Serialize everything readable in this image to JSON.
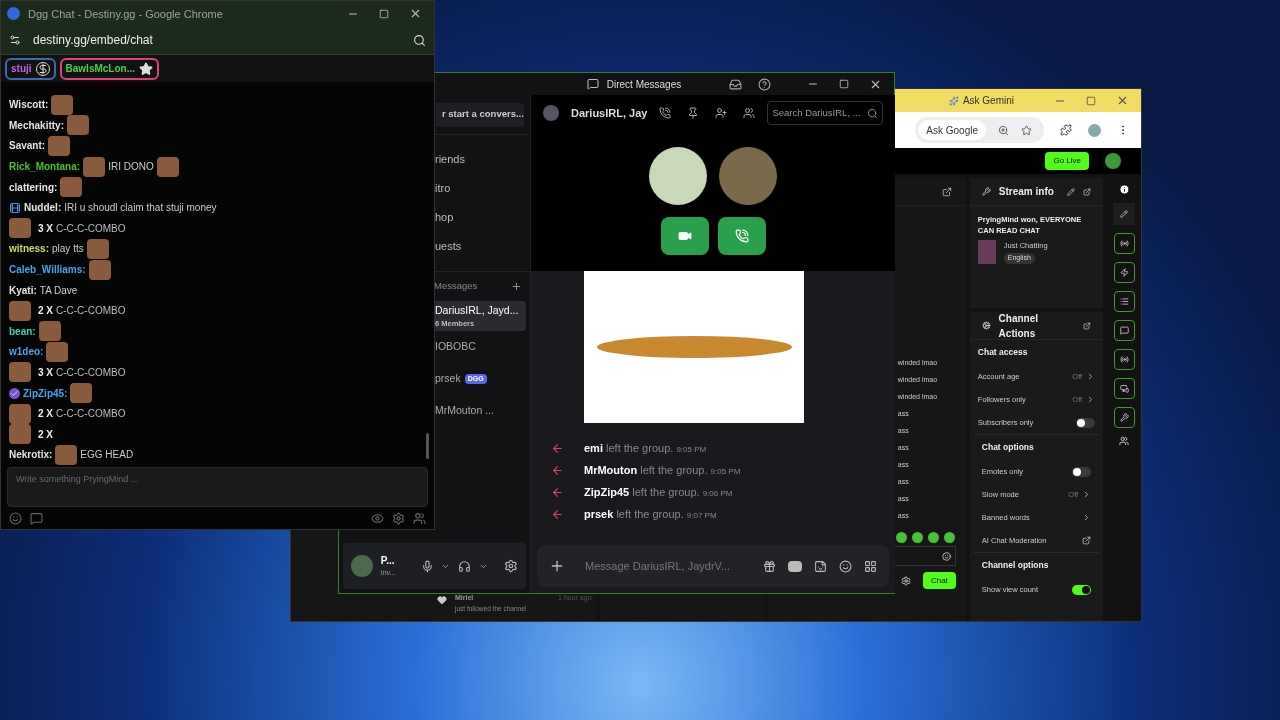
{
  "dgg_window": {
    "title": "Dgg Chat - Destiny.gg - Google Chrome",
    "url": "destiny.gg/embed/chat",
    "pinned": [
      {
        "label": "stuji",
        "kind": "coin"
      },
      {
        "label": "BawlsMcLon...",
        "kind": "star"
      }
    ],
    "messages": [
      {
        "kind": "message",
        "user": "Wiscott:",
        "color": "#e5e5e5",
        "parts": [
          {
            "kind": "emote"
          }
        ]
      },
      {
        "kind": "message",
        "user": "Mechakitty:",
        "color": "#e5e5e5",
        "parts": [
          {
            "kind": "emote"
          }
        ]
      },
      {
        "kind": "message",
        "user": "Savant:",
        "color": "#e5e5e5",
        "parts": [
          {
            "kind": "emote"
          }
        ]
      },
      {
        "kind": "message",
        "user": "Rick_Montana:",
        "color": "#4fc12e",
        "parts": [
          {
            "kind": "emote"
          },
          {
            "kind": "text",
            "text": "IRI DONO"
          },
          {
            "kind": "emote"
          }
        ]
      },
      {
        "kind": "message",
        "user": "clattering:",
        "color": "#e5e5e5",
        "parts": [
          {
            "kind": "emote"
          }
        ]
      },
      {
        "kind": "message",
        "user": "Nuddel:",
        "color": "#e5e5e5",
        "flair": {
          "kind": "clapper"
        },
        "parts": [
          {
            "kind": "text",
            "text": "IRI u shoudl claim that stuji money"
          }
        ]
      },
      {
        "kind": "combo",
        "count": "3 X",
        "text": "C-C-C-COMBO"
      },
      {
        "kind": "message",
        "user": "witness:",
        "color": "#c8e04a",
        "parts": [
          {
            "kind": "text",
            "text": "play tts"
          },
          {
            "kind": "emote"
          }
        ]
      },
      {
        "kind": "message",
        "user": "Caleb_Williams:",
        "color": "#4aa3ee",
        "parts": [
          {
            "kind": "emote"
          }
        ]
      },
      {
        "kind": "message",
        "user": "Kyati:",
        "color": "#e5e5e5",
        "parts": [
          {
            "kind": "text",
            "text": "TA Dave"
          }
        ]
      },
      {
        "kind": "combo",
        "count": "2 X",
        "text": "C-C-C-COMBO"
      },
      {
        "kind": "message",
        "user": "bean:",
        "color": "#3ed3b8",
        "parts": [
          {
            "kind": "emote"
          }
        ]
      },
      {
        "kind": "message",
        "user": "w1deo:",
        "color": "#4aa3ee",
        "parts": [
          {
            "kind": "emote"
          }
        ]
      },
      {
        "kind": "combo",
        "count": "3 X",
        "text": "C-C-C-COMBO"
      },
      {
        "kind": "message",
        "user": "ZipZip45:",
        "color": "#4aa3ee",
        "flair": {
          "kind": "verified"
        },
        "parts": [
          {
            "kind": "emote"
          }
        ]
      },
      {
        "kind": "combo",
        "count": "2 X",
        "text": "C-C-C-COMBO"
      },
      {
        "kind": "combo",
        "count": "2 X"
      },
      {
        "kind": "message",
        "user": "Nekrotix:",
        "color": "#e5e5e5",
        "parts": [
          {
            "kind": "emote"
          },
          {
            "kind": "text",
            "text": "EGG HEAD"
          }
        ]
      }
    ],
    "input": {
      "placeholder": "Write something PryingMind ..."
    }
  },
  "discord": {
    "title": "Direct Messages",
    "search": "r start a convers...",
    "nav": [
      "riends",
      "itro",
      "hop",
      "uests"
    ],
    "dm_header": "Messages",
    "dms": [
      {
        "name": "DariusIRL, Jayd...",
        "sub": "6 Members",
        "selected": true
      },
      {
        "name": "IOBOBC",
        "selected": false
      },
      {
        "name": "prsek",
        "tag": "DGG",
        "selected": false
      },
      {
        "name": "MrMouton ...",
        "selected": false
      }
    ],
    "user": {
      "name": "P...",
      "status": "Inv..."
    },
    "channel": "DariusIRL, Jay",
    "channel_search": "Search DariusIRL, ...",
    "events": [
      {
        "user": "emi",
        "action": "left the group.",
        "time": "9:05 PM"
      },
      {
        "user": "MrMouton",
        "action": "left the group.",
        "time": "9:05 PM"
      },
      {
        "user": "ZipZip45",
        "action": "left the group.",
        "time": "9:06 PM"
      },
      {
        "user": "prsek",
        "action": "left the group.",
        "time": "9:07 PM"
      }
    ],
    "composer": {
      "placeholder": "Message DariusIRL, JaydrV..."
    }
  },
  "kick": {
    "tab": "Ask Gemini",
    "omnibox": "Ask Google",
    "go_live": "Go Live",
    "activity": {
      "user": "Miriel",
      "time": "1 hour ago",
      "text": "just followed the channel"
    },
    "chat_lines": [
      "winded lmao",
      "winded lmao",
      "winded lmao",
      "ass",
      "ass",
      "ass",
      "ass",
      "ass",
      "ass",
      "ass"
    ],
    "chat_button": "Chat",
    "stream_info": {
      "title": "Stream info",
      "stream_title": "PryingMind won, EVERYONE CAN READ CHAT",
      "category": "Just Chatting",
      "language": "English"
    },
    "channel_actions": {
      "title": "Channel Actions",
      "sections": [
        {
          "title": "Chat access",
          "items": [
            {
              "label": "Account age",
              "kind": "value",
              "value": "Off"
            },
            {
              "label": "Followers only",
              "kind": "value",
              "value": "Off"
            },
            {
              "label": "Subscribers only",
              "kind": "toggle",
              "on": false
            }
          ]
        },
        {
          "title": "Chat options",
          "items": [
            {
              "label": "Emotes only",
              "kind": "toggle",
              "on": false
            },
            {
              "label": "Slow mode",
              "kind": "value",
              "value": "Off"
            },
            {
              "label": "Banned words",
              "kind": "arrow"
            },
            {
              "label": "AI Chat Moderation",
              "kind": "external"
            }
          ]
        },
        {
          "title": "Channel options",
          "items": [
            {
              "label": "Show view count",
              "kind": "toggle",
              "on": true
            }
          ]
        }
      ]
    }
  }
}
